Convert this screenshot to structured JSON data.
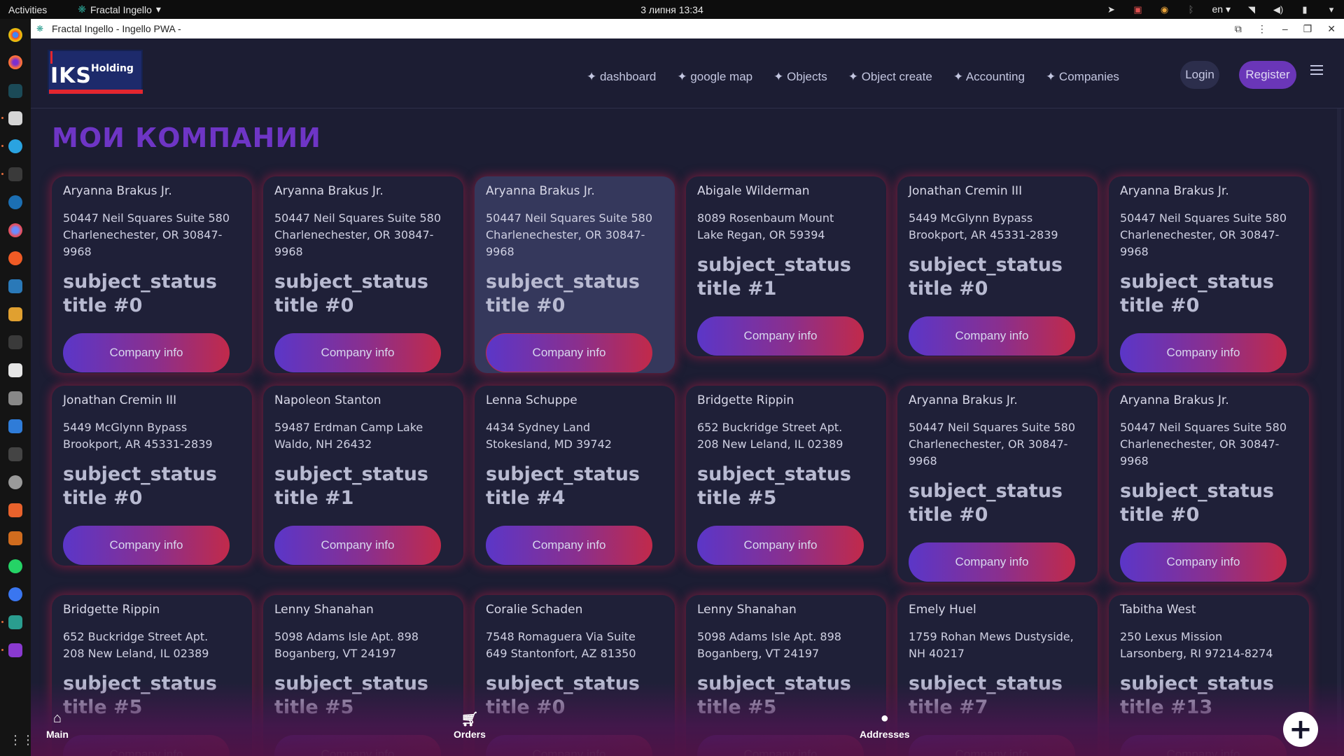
{
  "system": {
    "activities": "Activities",
    "app_menu": "Fractal Ingello",
    "clock": "3 липня  13:34",
    "lang": "en"
  },
  "window": {
    "title": "Fractal Ingello - Ingello PWA -"
  },
  "header": {
    "logo_text": "IKS",
    "logo_sub": "Holding",
    "nav": [
      "✦ dashboard",
      "✦ google map",
      "✦ Objects",
      "✦ Object create",
      "✦ Accounting",
      "✦ Companies"
    ],
    "login": "Login",
    "register": "Register"
  },
  "page": {
    "title": "МОИ КОМПАНИИ"
  },
  "cards": [
    {
      "name": "Aryanna Brakus Jr.",
      "addr1": "50447 Neil Squares Suite 580",
      "addr2": "Charlenechester, OR 30847-",
      "addr3": "9968",
      "status1": "subject_status",
      "status2": "title #0",
      "button": "Company info"
    },
    {
      "name": "Aryanna Brakus Jr.",
      "addr1": "50447 Neil Squares Suite 580",
      "addr2": "Charlenechester, OR 30847-",
      "addr3": "9968",
      "status1": "subject_status",
      "status2": "title #0",
      "button": "Company info"
    },
    {
      "name": "Aryanna Brakus Jr.",
      "addr1": "50447 Neil Squares Suite 580",
      "addr2": "Charlenechester, OR 30847-",
      "addr3": "9968",
      "status1": "subject_status",
      "status2": "title #0",
      "button": "Company info"
    },
    {
      "name": "Abigale Wilderman",
      "addr1": "8089 Rosenbaum Mount",
      "addr2": "Lake Regan, OR 59394",
      "addr3": "",
      "status1": "subject_status",
      "status2": "title #1",
      "button": "Company info"
    },
    {
      "name": "Jonathan Cremin III",
      "addr1": "5449 McGlynn Bypass",
      "addr2": "Brookport, AR 45331-2839",
      "addr3": "",
      "status1": "subject_status",
      "status2": "title #0",
      "button": "Company info"
    },
    {
      "name": "Aryanna Brakus Jr.",
      "addr1": "50447 Neil Squares Suite 580",
      "addr2": "Charlenechester, OR 30847-",
      "addr3": "9968",
      "status1": "subject_status",
      "status2": "title #0",
      "button": "Company info"
    },
    {
      "name": "Jonathan Cremin III",
      "addr1": "5449 McGlynn Bypass",
      "addr2": "Brookport, AR 45331-2839",
      "addr3": "",
      "status1": "subject_status",
      "status2": "title #0",
      "button": "Company info"
    },
    {
      "name": "Napoleon Stanton",
      "addr1": "59487 Erdman Camp Lake",
      "addr2": "Waldo, NH 26432",
      "addr3": "",
      "status1": "subject_status",
      "status2": "title #1",
      "button": "Company info"
    },
    {
      "name": "Lenna Schuppe",
      "addr1": "4434 Sydney Land",
      "addr2": "Stokesland, MD 39742",
      "addr3": "",
      "status1": "subject_status",
      "status2": "title #4",
      "button": "Company info"
    },
    {
      "name": "Bridgette Rippin",
      "addr1": "652 Buckridge Street Apt.",
      "addr2": "208 New Leland, IL 02389",
      "addr3": "",
      "status1": "subject_status",
      "status2": "title #5",
      "button": "Company info"
    },
    {
      "name": "Aryanna Brakus Jr.",
      "addr1": "50447 Neil Squares Suite 580",
      "addr2": "Charlenechester, OR 30847-",
      "addr3": "9968",
      "status1": "subject_status",
      "status2": "title #0",
      "button": "Company info"
    },
    {
      "name": "Aryanna Brakus Jr.",
      "addr1": "50447 Neil Squares Suite 580",
      "addr2": "Charlenechester, OR 30847-",
      "addr3": "9968",
      "status1": "subject_status",
      "status2": "title #0",
      "button": "Company info"
    },
    {
      "name": "Bridgette Rippin",
      "addr1": "652 Buckridge Street Apt.",
      "addr2": "208 New Leland, IL 02389",
      "addr3": "",
      "status1": "subject_status",
      "status2": "title #5",
      "button": "Company info"
    },
    {
      "name": "Lenny Shanahan",
      "addr1": "5098 Adams Isle Apt. 898",
      "addr2": "Boganberg, VT 24197",
      "addr3": "",
      "status1": "subject_status",
      "status2": "title #5",
      "button": "Company info"
    },
    {
      "name": "Coralie Schaden",
      "addr1": "7548 Romaguera Via Suite",
      "addr2": "649 Stantonfort, AZ 81350",
      "addr3": "",
      "status1": "subject_status",
      "status2": "title #0",
      "button": "Company info"
    },
    {
      "name": "Lenny Shanahan",
      "addr1": "5098 Adams Isle Apt. 898",
      "addr2": "Boganberg, VT 24197",
      "addr3": "",
      "status1": "subject_status",
      "status2": "title #5",
      "button": "Company info"
    },
    {
      "name": "Emely Huel",
      "addr1": "1759 Rohan Mews Dustyside,",
      "addr2": "NH 40217",
      "addr3": "",
      "status1": "subject_status",
      "status2": "title #7",
      "button": "Company info"
    },
    {
      "name": "Tabitha West",
      "addr1": "250 Lexus Mission",
      "addr2": "Larsonberg, RI 97214-8274",
      "addr3": "",
      "status1": "subject_status",
      "status2": "title #13",
      "button": "Company info"
    }
  ],
  "bottom_nav": {
    "main": "Main",
    "orders": "Orders",
    "addresses": "Addresses"
  },
  "colors": {
    "background": "#1c1d33",
    "title_accent": "#6e35c5",
    "card_glow": "#b91e46",
    "register_button": "#6a36b8"
  }
}
